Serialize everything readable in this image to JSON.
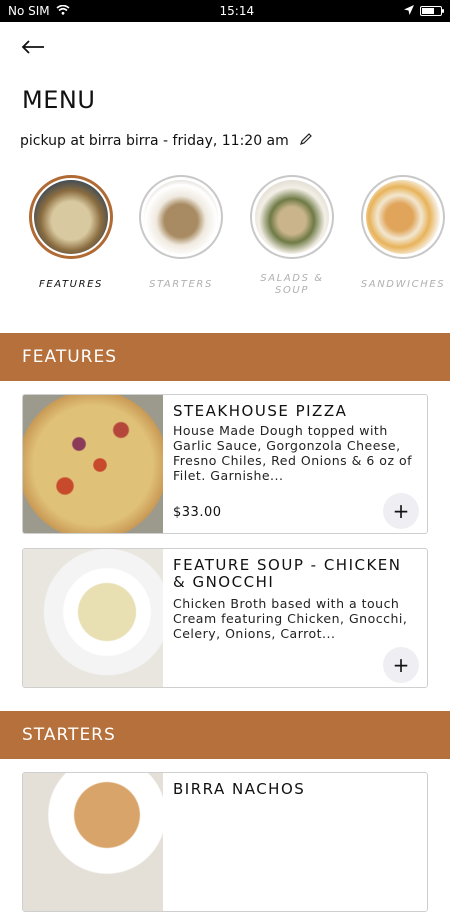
{
  "status_bar": {
    "carrier": "No SIM",
    "time": "15:14",
    "wifi_icon": "wifi-icon",
    "location_icon": "location-arrow-icon",
    "battery_icon": "battery-icon"
  },
  "header": {
    "back_icon": "back-arrow-icon",
    "title": "MENU",
    "pickup_text": "pickup at birra birra - friday, 11:20 am",
    "edit_icon": "pencil-icon"
  },
  "categories": [
    {
      "label": "FEATURES",
      "active": true
    },
    {
      "label": "STARTERS",
      "active": false
    },
    {
      "label": "SALADS & SOUP",
      "active": false
    },
    {
      "label": "SANDWICHES",
      "active": false
    }
  ],
  "sections": [
    {
      "title": "FEATURES",
      "items": [
        {
          "name": "STEAKHOUSE PIZZA",
          "description": "House Made Dough topped with Garlic Sauce, Gorgonzola Cheese, Fresno Chiles, Red Onions & 6 oz of Filet. Garnishe...",
          "price": "$33.00",
          "add_label": "+"
        },
        {
          "name": "FEATURE SOUP - CHICKEN & GNOCCHI",
          "description": "Chicken Broth based with a touch Cream featuring Chicken, Gnocchi, Celery, Onions, Carrot...",
          "price": "",
          "add_label": "+"
        }
      ]
    },
    {
      "title": "STARTERS",
      "items": [
        {
          "name": "BIRRA NACHOS",
          "description": "",
          "price": "",
          "add_label": "+"
        }
      ]
    }
  ],
  "colors": {
    "accent": "#b5703b",
    "active_ring": "#b06a34",
    "inactive_ring": "#c8c8c8",
    "inactive_label": "#b0b0b0"
  }
}
